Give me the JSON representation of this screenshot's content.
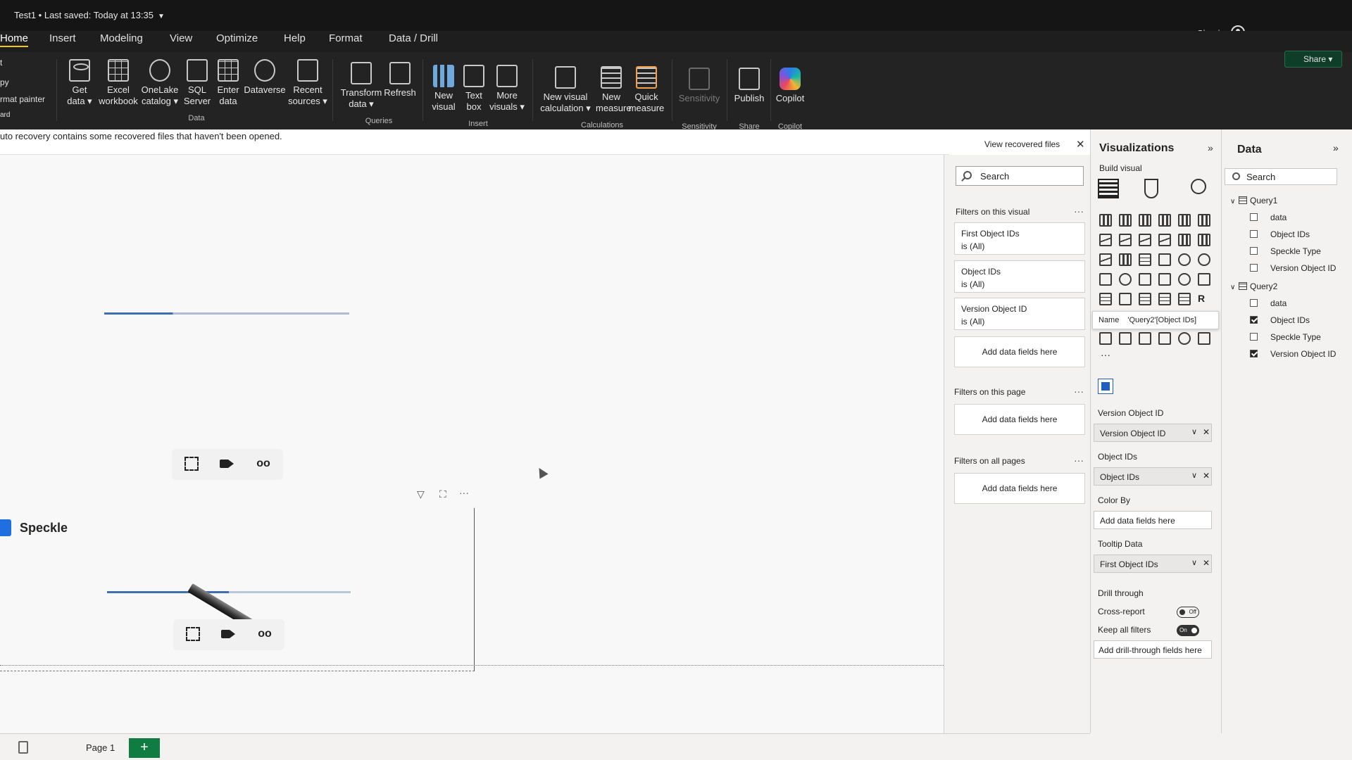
{
  "window": {
    "title": "Test1 • Last saved: Today at 13:35",
    "signin": "Sign in"
  },
  "tabs": [
    "Home",
    "Insert",
    "Modeling",
    "View",
    "Optimize",
    "Help",
    "Format",
    "Data / Drill"
  ],
  "clipboard": [
    "t",
    "py",
    "rmat painter",
    "ard"
  ],
  "ribbon": {
    "get_data": "Get data ▾",
    "excel": "Excel workbook",
    "onelake": "OneLake catalog ▾",
    "sql": "SQL Server",
    "enter_data": "Enter data",
    "dataverse": "Dataverse",
    "recent": "Recent sources ▾",
    "transform": "Transform data ▾",
    "refresh": "Refresh",
    "new_visual": "New visual",
    "text_box": "Text box",
    "more_visuals": "More visuals ▾",
    "new_visual_calc": "New visual calculation ▾",
    "new_measure": "New measure",
    "quick_measure": "Quick measure",
    "sensitivity": "Sensitivity",
    "publish": "Publish",
    "copilot": "Copilot",
    "groups": {
      "data": "Data",
      "queries": "Queries",
      "insert": "Insert",
      "calculations": "Calculations",
      "sensitivity": "Sensitivity",
      "share": "Share",
      "copilot": "Copilot"
    },
    "share_button": "Share ▾"
  },
  "notification": {
    "message": "uto recovery contains some recovered files that haven't been opened.",
    "view_button": "View recovered files",
    "close": "✕"
  },
  "canvas": {
    "visual_title": "Speckle",
    "visual_header_icons": [
      "filter-icon",
      "focus-mode-icon",
      "more-options-icon"
    ]
  },
  "filters": {
    "search_placeholder": "Search",
    "on_visual": "Filters on this visual",
    "cards": [
      {
        "name": "First Object IDs",
        "state": "is (All)"
      },
      {
        "name": "Object IDs",
        "state": "is (All)"
      },
      {
        "name": "Version Object ID",
        "state": "is (All)"
      }
    ],
    "add_fields": "Add data fields here",
    "on_page": "Filters on this page",
    "on_all_pages": "Filters on all pages",
    "more": "···"
  },
  "visualizations": {
    "title": "Visualizations",
    "build_visual": "Build visual",
    "tooltip_name": "Name",
    "tooltip_value": "'Query2'[Object IDs]",
    "more": "···",
    "wells": {
      "version_object_id_label": "Version Object ID",
      "version_object_id_value": "Version Object ID",
      "object_ids_label": "Object IDs",
      "object_ids_value": "Object IDs",
      "color_by_label": "Color By",
      "color_by_value": "Add data fields here",
      "tooltip_label": "Tooltip Data",
      "tooltip_value": "First Object IDs"
    },
    "drill_through": "Drill through",
    "cross_report": "Cross-report",
    "cross_report_state": "Off",
    "keep_filters": "Keep all filters",
    "keep_filters_state": "On",
    "add_drill": "Add drill-through fields here"
  },
  "data_pane": {
    "title": "Data",
    "search_placeholder": "Search",
    "tables": [
      {
        "name": "Query1",
        "fields": [
          {
            "name": "data",
            "checked": false
          },
          {
            "name": "Object IDs",
            "checked": false
          },
          {
            "name": "Speckle Type",
            "checked": false
          },
          {
            "name": "Version Object ID",
            "checked": false
          }
        ]
      },
      {
        "name": "Query2",
        "fields": [
          {
            "name": "data",
            "checked": false
          },
          {
            "name": "Object IDs",
            "checked": true
          },
          {
            "name": "Speckle Type",
            "checked": false
          },
          {
            "name": "Version Object ID",
            "checked": true
          }
        ]
      }
    ]
  },
  "pages": {
    "page1": "Page 1",
    "add": "+"
  },
  "colors": {
    "accent_yellow": "#f2c811",
    "speckle_blue": "#1f6fe0",
    "add_page_green": "#107c41"
  }
}
